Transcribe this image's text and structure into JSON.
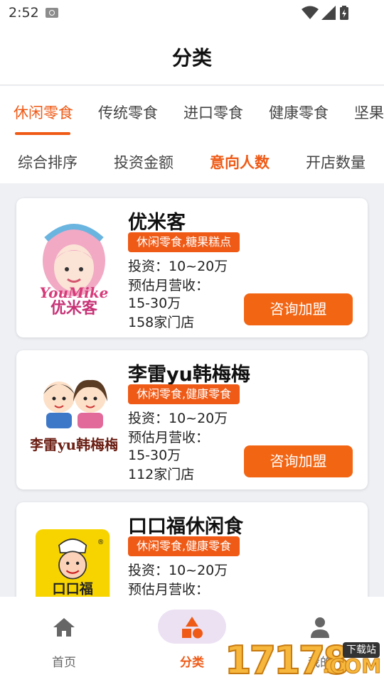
{
  "status_bar": {
    "time": "2:52"
  },
  "header": {
    "title": "分类"
  },
  "category_tabs": [
    {
      "label": "休闲零食",
      "active": true
    },
    {
      "label": "传统零食",
      "active": false
    },
    {
      "label": "进口零食",
      "active": false
    },
    {
      "label": "健康零食",
      "active": false
    },
    {
      "label": "坚果",
      "active": false
    }
  ],
  "sort_tabs": [
    {
      "label": "综合排序",
      "active": false
    },
    {
      "label": "投资金额",
      "active": false
    },
    {
      "label": "意向人数",
      "active": true
    },
    {
      "label": "开店数量",
      "active": false
    }
  ],
  "brands": [
    {
      "name": "优米客",
      "tags": "休闲零食,糖果糕点",
      "investment": "投资：10~20万",
      "revenue_label": "预估月营收：",
      "revenue": "15-30万",
      "stores": "158家门店",
      "cta": "咨询加盟",
      "logo_text": "YouMike",
      "logo_text_cn": "优米客"
    },
    {
      "name": "李雷yu韩梅梅",
      "tags": "休闲零食,健康零食",
      "investment": "投资：10~20万",
      "revenue_label": "预估月营收：",
      "revenue": "15-30万",
      "stores": "112家门店",
      "cta": "咨询加盟",
      "logo_text": "李雷yu韩梅梅"
    },
    {
      "name": "口口福休闲食",
      "tags": "休闲零食,健康零食",
      "investment": "投资：10~20万",
      "revenue_label": "预估月营收：",
      "logo_text": "口口福"
    }
  ],
  "bottom_nav": [
    {
      "label": "首页",
      "icon": "home-icon",
      "active": false
    },
    {
      "label": "分类",
      "icon": "shapes-icon",
      "active": true
    },
    {
      "label": "我的",
      "icon": "person-icon",
      "active": false
    }
  ],
  "watermark": {
    "number": "17178",
    "suffix": ".COM",
    "badge": "下载站"
  },
  "colors": {
    "accent": "#ef5a16",
    "button": "#f26513",
    "nav_pill": "#ece1f3",
    "background": "#eef0f4"
  }
}
